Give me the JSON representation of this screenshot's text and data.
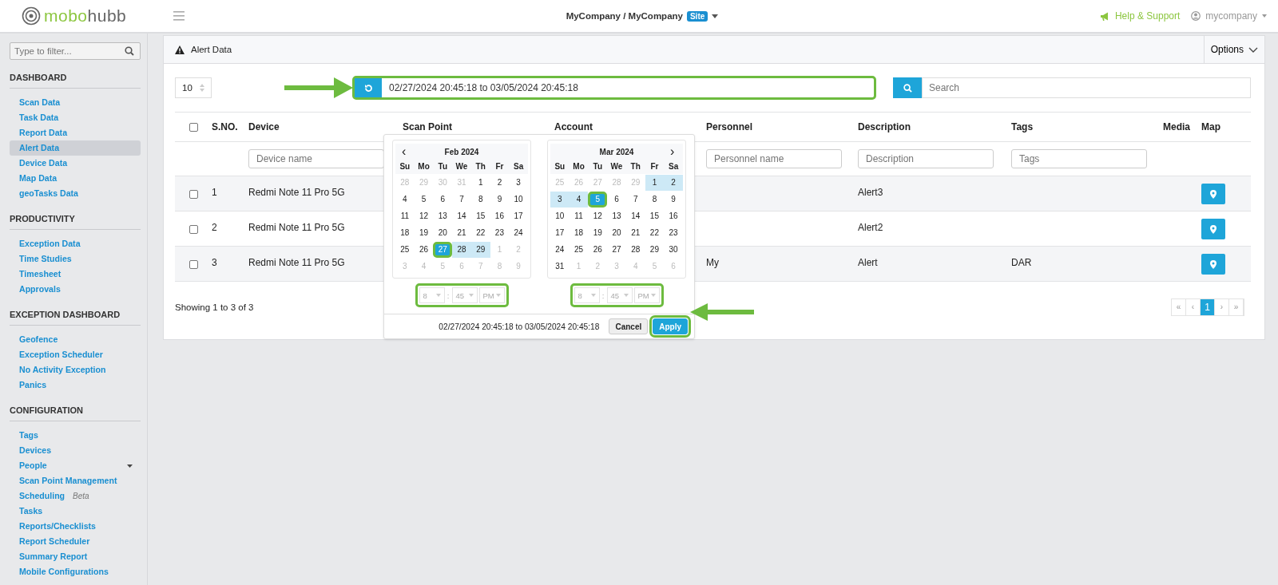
{
  "header": {
    "logo": {
      "first": "mobo",
      "second": "hubb"
    },
    "breadcrumb": "MyCompany / MyCompany",
    "site_badge": "Site",
    "help": "Help & Support",
    "user": "mycompany"
  },
  "sidebar": {
    "filter_placeholder": "Type to filter...",
    "sections": [
      {
        "title": "DASHBOARD",
        "items": [
          {
            "label": "Scan Data",
            "kind": "link",
            "selected": false
          },
          {
            "label": "Task Data",
            "kind": "link",
            "selected": false
          },
          {
            "label": "Report Data",
            "kind": "link",
            "selected": false
          },
          {
            "label": "Alert Data",
            "kind": "link",
            "selected": true
          },
          {
            "label": "Device Data",
            "kind": "link",
            "selected": false
          },
          {
            "label": "Map Data",
            "kind": "link",
            "selected": false
          },
          {
            "label": "geoTasks Data",
            "kind": "link",
            "selected": false
          }
        ]
      },
      {
        "title": "PRODUCTIVITY",
        "items": [
          {
            "label": "Exception Data",
            "kind": "link",
            "selected": false
          },
          {
            "label": "Time Studies",
            "kind": "link",
            "selected": false
          },
          {
            "label": "Timesheet",
            "kind": "link",
            "selected": false
          },
          {
            "label": "Approvals",
            "kind": "link",
            "selected": false
          }
        ]
      },
      {
        "title": "EXCEPTION DASHBOARD",
        "items": [
          {
            "label": "Geofence",
            "kind": "link",
            "selected": false
          },
          {
            "label": "Exception Scheduler",
            "kind": "link",
            "selected": false
          },
          {
            "label": "No Activity Exception",
            "kind": "link",
            "selected": false
          },
          {
            "label": "Panics",
            "kind": "link",
            "selected": false
          }
        ]
      },
      {
        "title": "CONFIGURATION",
        "items": [
          {
            "label": "Tags",
            "kind": "link",
            "selected": false
          },
          {
            "label": "Devices",
            "kind": "link",
            "selected": false
          },
          {
            "label": "People",
            "kind": "menu",
            "selected": false
          },
          {
            "label": "Scan Point Management",
            "kind": "link",
            "selected": false
          },
          {
            "label": "Scheduling",
            "kind": "tagged",
            "tag": "Beta",
            "selected": false
          },
          {
            "label": "Tasks",
            "kind": "link",
            "selected": false
          },
          {
            "label": "Reports/Checklists",
            "kind": "link",
            "selected": false
          },
          {
            "label": "Report Scheduler",
            "kind": "link",
            "selected": false
          },
          {
            "label": "Summary Report",
            "kind": "link",
            "selected": false
          },
          {
            "label": "Mobile Configurations",
            "kind": "link",
            "selected": false
          }
        ]
      }
    ]
  },
  "panel": {
    "title": "Alert Data",
    "options": "Options",
    "page_size": "10",
    "date_range": {
      "value": "02/27/2024 20:45:18 to 03/05/2024 20:45:18",
      "highlighted": true
    },
    "search_placeholder": "Search",
    "table": {
      "columns": [
        "S.NO.",
        "Device",
        "Scan Point",
        "Account",
        "Personnel",
        "Description",
        "Tags",
        "Media",
        "Map"
      ],
      "select_all_checked": false,
      "filters": {
        "device": {
          "placeholder": "Device name"
        },
        "personnel": {
          "placeholder": "Personnel name"
        },
        "description": {
          "placeholder": "Description"
        },
        "tags": {
          "placeholder": "Tags"
        }
      },
      "rows": [
        {
          "checked": false,
          "sno": "1",
          "device": "Redmi Note 11 Pro 5G",
          "description": "Alert3"
        },
        {
          "checked": false,
          "sno": "2",
          "device": "Redmi Note 11 Pro 5G",
          "description": "Alert2"
        },
        {
          "checked": false,
          "sno": "3",
          "device": "Redmi Note 11 Pro 5G",
          "personnel": "My",
          "description": "Alert",
          "tags": "DAR"
        }
      ]
    },
    "footer": "Showing 1 to 3 of 3",
    "pagination": [
      {
        "label": "«",
        "selected": false
      },
      {
        "label": "‹",
        "selected": false
      },
      {
        "label": "1",
        "selected": true
      },
      {
        "label": "›",
        "selected": false
      },
      {
        "label": "»",
        "selected": false
      }
    ]
  },
  "datepicker": {
    "months": [
      {
        "title": "Feb 2024",
        "prev": "‹",
        "weekdays": [
          "Su",
          "Mo",
          "Tu",
          "We",
          "Th",
          "Fr",
          "Sa"
        ],
        "weeks": [
          [
            {
              "day": "28",
              "kind": "other"
            },
            {
              "day": "29",
              "kind": "other"
            },
            {
              "day": "30",
              "kind": "other"
            },
            {
              "day": "31",
              "kind": "other"
            },
            {
              "day": "1",
              "kind": "normal"
            },
            {
              "day": "2",
              "kind": "normal"
            },
            {
              "day": "3",
              "kind": "normal"
            }
          ],
          [
            {
              "day": "4",
              "kind": "normal"
            },
            {
              "day": "5",
              "kind": "normal"
            },
            {
              "day": "6",
              "kind": "normal"
            },
            {
              "day": "7",
              "kind": "normal"
            },
            {
              "day": "8",
              "kind": "normal"
            },
            {
              "day": "9",
              "kind": "normal"
            },
            {
              "day": "10",
              "kind": "normal"
            }
          ],
          [
            {
              "day": "11",
              "kind": "normal"
            },
            {
              "day": "12",
              "kind": "normal"
            },
            {
              "day": "13",
              "kind": "normal"
            },
            {
              "day": "14",
              "kind": "normal"
            },
            {
              "day": "15",
              "kind": "normal"
            },
            {
              "day": "16",
              "kind": "normal"
            },
            {
              "day": "17",
              "kind": "normal"
            }
          ],
          [
            {
              "day": "18",
              "kind": "normal"
            },
            {
              "day": "19",
              "kind": "normal"
            },
            {
              "day": "20",
              "kind": "normal"
            },
            {
              "day": "21",
              "kind": "normal"
            },
            {
              "day": "22",
              "kind": "normal"
            },
            {
              "day": "23",
              "kind": "normal"
            },
            {
              "day": "24",
              "kind": "normal"
            }
          ],
          [
            {
              "day": "25",
              "kind": "normal"
            },
            {
              "day": "26",
              "kind": "normal"
            },
            {
              "day": "27",
              "kind": "start"
            },
            {
              "day": "28",
              "kind": "range"
            },
            {
              "day": "29",
              "kind": "range"
            },
            {
              "day": "1",
              "kind": "other"
            },
            {
              "day": "2",
              "kind": "other"
            }
          ],
          [
            {
              "day": "3",
              "kind": "other"
            },
            {
              "day": "4",
              "kind": "other"
            },
            {
              "day": "5",
              "kind": "other"
            },
            {
              "day": "6",
              "kind": "other"
            },
            {
              "day": "7",
              "kind": "other"
            },
            {
              "day": "8",
              "kind": "other"
            },
            {
              "day": "9",
              "kind": "other"
            }
          ]
        ],
        "time": {
          "hour": "8",
          "separator": ":",
          "minute": "45",
          "period": "PM",
          "highlighted": true
        }
      },
      {
        "title": "Mar 2024",
        "next": "›",
        "weekdays": [
          "Su",
          "Mo",
          "Tu",
          "We",
          "Th",
          "Fr",
          "Sa"
        ],
        "weeks": [
          [
            {
              "day": "25",
              "kind": "other"
            },
            {
              "day": "26",
              "kind": "other"
            },
            {
              "day": "27",
              "kind": "other"
            },
            {
              "day": "28",
              "kind": "other"
            },
            {
              "day": "29",
              "kind": "other"
            },
            {
              "day": "1",
              "kind": "range"
            },
            {
              "day": "2",
              "kind": "range"
            }
          ],
          [
            {
              "day": "3",
              "kind": "range"
            },
            {
              "day": "4",
              "kind": "range"
            },
            {
              "day": "5",
              "kind": "end"
            },
            {
              "day": "6",
              "kind": "normal"
            },
            {
              "day": "7",
              "kind": "normal"
            },
            {
              "day": "8",
              "kind": "normal"
            },
            {
              "day": "9",
              "kind": "normal"
            }
          ],
          [
            {
              "day": "10",
              "kind": "normal"
            },
            {
              "day": "11",
              "kind": "normal"
            },
            {
              "day": "12",
              "kind": "normal"
            },
            {
              "day": "13",
              "kind": "normal"
            },
            {
              "day": "14",
              "kind": "normal"
            },
            {
              "day": "15",
              "kind": "normal"
            },
            {
              "day": "16",
              "kind": "normal"
            }
          ],
          [
            {
              "day": "17",
              "kind": "normal"
            },
            {
              "day": "18",
              "kind": "normal"
            },
            {
              "day": "19",
              "kind": "normal"
            },
            {
              "day": "20",
              "kind": "normal"
            },
            {
              "day": "21",
              "kind": "normal"
            },
            {
              "day": "22",
              "kind": "normal"
            },
            {
              "day": "23",
              "kind": "normal"
            }
          ],
          [
            {
              "day": "24",
              "kind": "normal"
            },
            {
              "day": "25",
              "kind": "normal"
            },
            {
              "day": "26",
              "kind": "normal"
            },
            {
              "day": "27",
              "kind": "normal"
            },
            {
              "day": "28",
              "kind": "normal"
            },
            {
              "day": "29",
              "kind": "normal"
            },
            {
              "day": "30",
              "kind": "normal"
            }
          ],
          [
            {
              "day": "31",
              "kind": "normal"
            },
            {
              "day": "1",
              "kind": "other"
            },
            {
              "day": "2",
              "kind": "other"
            },
            {
              "day": "3",
              "kind": "other"
            },
            {
              "day": "4",
              "kind": "other"
            },
            {
              "day": "5",
              "kind": "other"
            },
            {
              "day": "6",
              "kind": "other"
            }
          ]
        ],
        "time": {
          "hour": "8",
          "separator": ":",
          "minute": "45",
          "period": "PM",
          "highlighted": true
        }
      }
    ],
    "range_text": "02/27/2024 20:45:18 to 03/05/2024 20:45:18",
    "buttons": [
      {
        "label": "Cancel",
        "kind": "cancel",
        "highlighted": false
      },
      {
        "label": "Apply",
        "kind": "apply",
        "highlighted": true
      }
    ]
  }
}
